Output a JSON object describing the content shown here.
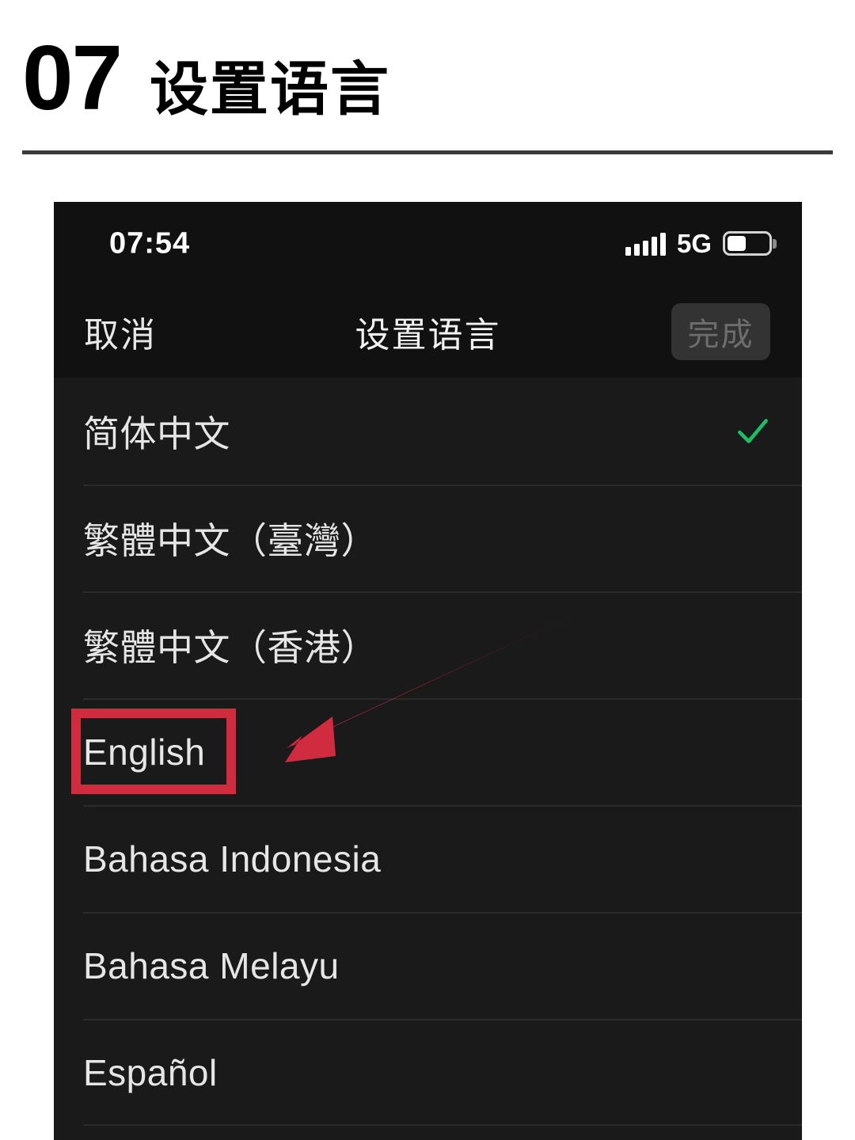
{
  "header": {
    "number": "07",
    "title": "设置语言"
  },
  "phone": {
    "statusbar": {
      "time": "07:54",
      "network": "5G",
      "signal_icon": "signal-bars-icon",
      "battery_icon": "battery-icon",
      "battery_level_percent": 45,
      "signal_bars": 5
    },
    "navbar": {
      "cancel_label": "取消",
      "title": "设置语言",
      "done_label": "完成",
      "done_enabled": false
    },
    "list": {
      "rows": [
        {
          "label": "简体中文",
          "selected": true
        },
        {
          "label": "繁體中文（臺灣）",
          "selected": false
        },
        {
          "label": "繁體中文（香港）",
          "selected": false
        },
        {
          "label": "English",
          "selected": false,
          "highlighted": true
        },
        {
          "label": "Bahasa Indonesia",
          "selected": false
        },
        {
          "label": "Bahasa Melayu",
          "selected": false
        },
        {
          "label": "Español",
          "selected": false
        }
      ]
    }
  },
  "annotations": {
    "highlight_box_color": "#d12b3f",
    "arrow_color": "#d12b3f",
    "checkmark_color": "#1dbf66"
  }
}
